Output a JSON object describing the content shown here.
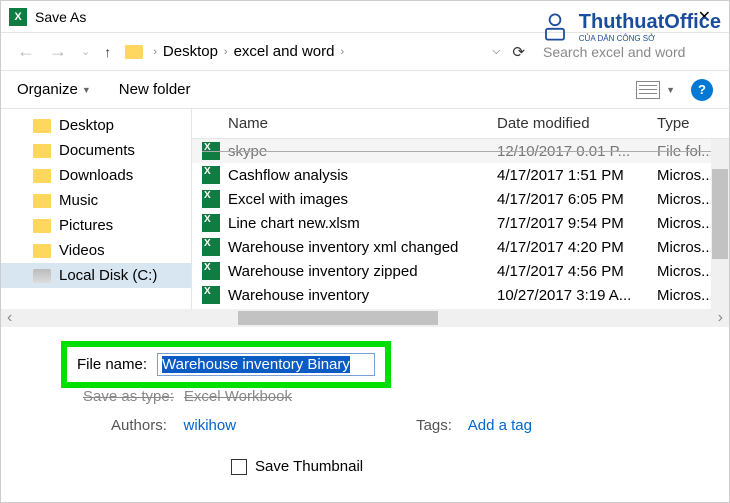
{
  "window": {
    "title": "Save As"
  },
  "nav": {
    "breadcrumbs": [
      "Desktop",
      "excel and word"
    ],
    "search_placeholder": "Search excel and word"
  },
  "toolbar": {
    "organize": "Organize",
    "newfolder": "New folder"
  },
  "sidebar": {
    "items": [
      {
        "label": "Desktop"
      },
      {
        "label": "Documents"
      },
      {
        "label": "Downloads"
      },
      {
        "label": "Music"
      },
      {
        "label": "Pictures"
      },
      {
        "label": "Videos"
      },
      {
        "label": "Local Disk (C:)"
      }
    ]
  },
  "columns": {
    "name": "Name",
    "modified": "Date modified",
    "type": "Type"
  },
  "files": [
    {
      "name": "skype",
      "modified": "12/10/2017 0.01 P...",
      "type": "File fol..."
    },
    {
      "name": "Cashflow analysis",
      "modified": "4/17/2017 1:51 PM",
      "type": "Micros..."
    },
    {
      "name": "Excel with images",
      "modified": "4/17/2017 6:05 PM",
      "type": "Micros..."
    },
    {
      "name": "Line chart new.xlsm",
      "modified": "7/17/2017 9:54 PM",
      "type": "Micros..."
    },
    {
      "name": "Warehouse inventory xml changed",
      "modified": "4/17/2017 4:20 PM",
      "type": "Micros..."
    },
    {
      "name": "Warehouse inventory zipped",
      "modified": "4/17/2017 4:56 PM",
      "type": "Micros..."
    },
    {
      "name": "Warehouse inventory",
      "modified": "10/27/2017 3:19 A...",
      "type": "Micros..."
    }
  ],
  "form": {
    "filename_label": "File name:",
    "filename_value": "Warehouse inventory Binary",
    "savetype_label": "Save as type:",
    "savetype_value": "Excel Workbook",
    "authors_label": "Authors:",
    "authors_value": "wikihow",
    "tags_label": "Tags:",
    "tags_value": "Add a tag",
    "save_thumbnail": "Save Thumbnail"
  },
  "watermark": {
    "brand": "ThuthuatOffice",
    "sub": "CỦA DÂN CÔNG SỞ"
  }
}
